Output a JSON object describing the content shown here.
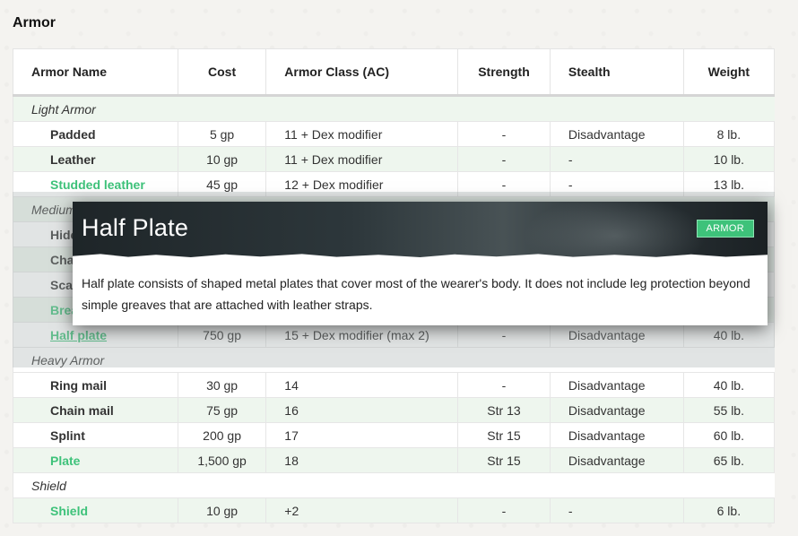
{
  "page": {
    "title": "Armor"
  },
  "table": {
    "headers": {
      "name": "Armor Name",
      "cost": "Cost",
      "ac": "Armor Class (AC)",
      "strength": "Strength",
      "stealth": "Stealth",
      "weight": "Weight"
    },
    "categories": {
      "light": "Light Armor",
      "medium": "Medium Armor",
      "heavy": "Heavy Armor",
      "shield": "Shield"
    },
    "light": [
      {
        "name": "Padded",
        "cost": "5 gp",
        "ac": "11 + Dex modifier",
        "strength": "-",
        "stealth": "Disadvantage",
        "weight": "8 lb."
      },
      {
        "name": "Leather",
        "cost": "10 gp",
        "ac": "11 + Dex modifier",
        "strength": "-",
        "stealth": "-",
        "weight": "10 lb."
      },
      {
        "name": "Studded leather",
        "cost": "45 gp",
        "ac": "12 + Dex modifier",
        "strength": "-",
        "stealth": "-",
        "weight": "13 lb."
      }
    ],
    "medium": [
      {
        "name": "Hide"
      },
      {
        "name": "Chain shirt"
      },
      {
        "name": "Scale mail"
      },
      {
        "name": "Breastplate"
      },
      {
        "name": "Half plate",
        "cost": "750 gp",
        "ac": "15 + Dex modifier (max 2)",
        "strength": "-",
        "stealth": "Disadvantage",
        "weight": "40 lb."
      }
    ],
    "heavy": [
      {
        "name": "Ring mail",
        "cost": "30 gp",
        "ac": "14",
        "strength": "-",
        "stealth": "Disadvantage",
        "weight": "40 lb."
      },
      {
        "name": "Chain mail",
        "cost": "75 gp",
        "ac": "16",
        "strength": "Str 13",
        "stealth": "Disadvantage",
        "weight": "55 lb."
      },
      {
        "name": "Splint",
        "cost": "200 gp",
        "ac": "17",
        "strength": "Str 15",
        "stealth": "Disadvantage",
        "weight": "60 lb."
      },
      {
        "name": "Plate",
        "cost": "1,500 gp",
        "ac": "18",
        "strength": "Str 15",
        "stealth": "Disadvantage",
        "weight": "65 lb."
      }
    ],
    "shield": [
      {
        "name": "Shield",
        "cost": "10 gp",
        "ac": "+2",
        "strength": "-",
        "stealth": "-",
        "weight": "6 lb."
      }
    ]
  },
  "tooltip": {
    "title": "Half Plate",
    "badge": "ARMOR",
    "description": "Half plate consists of shaped metal plates that cover most of the wearer's body. It does not include leg protection beyond simple greaves that are attached with leather straps."
  },
  "colors": {
    "link_dark": "#2a7d48",
    "link_light": "#3ec27a",
    "row_shade": "#eef6ee",
    "badge": "#3ec27a"
  }
}
